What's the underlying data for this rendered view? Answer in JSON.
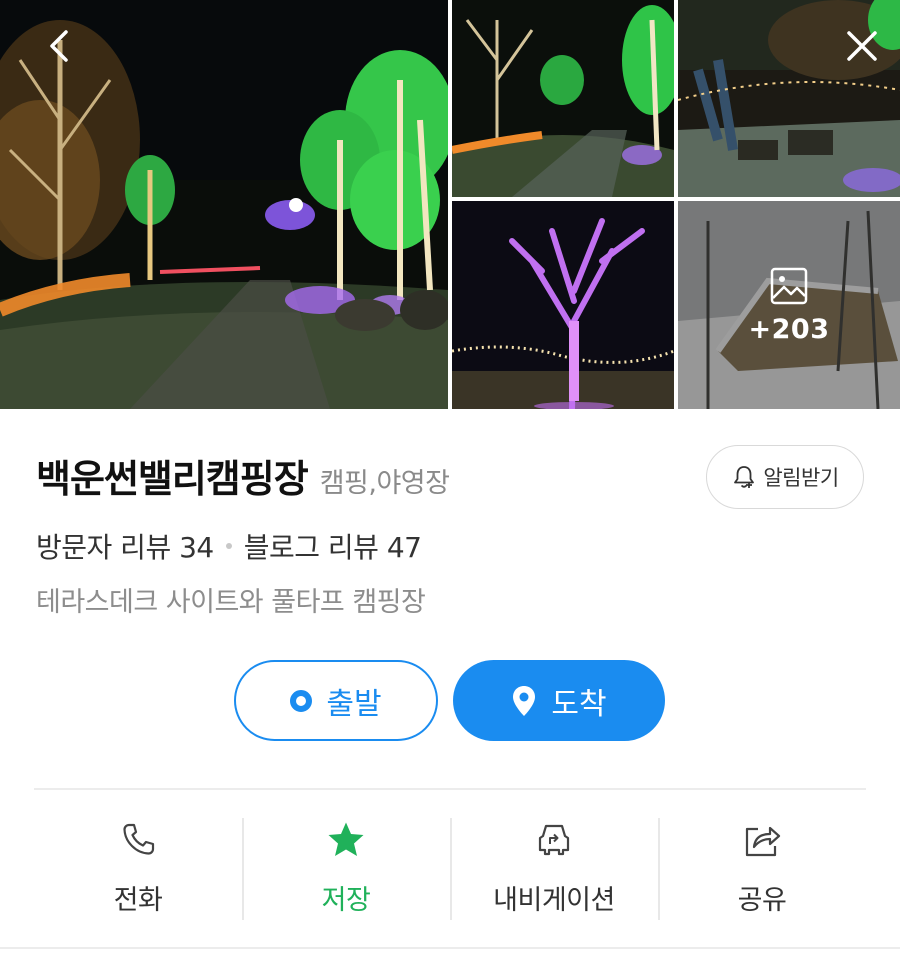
{
  "gallery": {
    "more_count": "+203",
    "icons": {
      "back": "back-chevron-icon",
      "close": "close-icon",
      "image": "image-icon"
    }
  },
  "place": {
    "name": "백운썬밸리캠핑장",
    "category": "캠핑,야영장",
    "description": "테라스데크 사이트와 풀타프 캠핑장"
  },
  "alarm": {
    "label": "알림받기",
    "icon": "bell-plus-icon"
  },
  "reviews": {
    "visitor": "방문자 리뷰 34",
    "blog": "블로그 리뷰 47"
  },
  "route": {
    "depart_label": "출발",
    "arrive_label": "도착"
  },
  "actions": [
    {
      "label": "전화",
      "icon": "phone-icon"
    },
    {
      "label": "저장",
      "icon": "star-icon"
    },
    {
      "label": "내비게이션",
      "icon": "car-navigation-icon"
    },
    {
      "label": "공유",
      "icon": "share-icon"
    }
  ],
  "colors": {
    "primary": "#1a8cf0",
    "save_green": "#20b15a",
    "muted_text": "#8d8d8d"
  }
}
